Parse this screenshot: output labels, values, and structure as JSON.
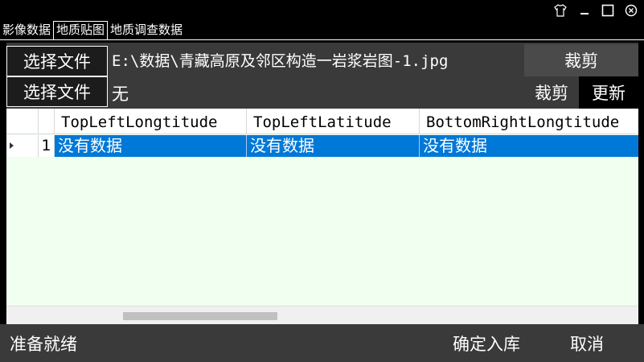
{
  "window": {
    "controls": [
      {
        "name": "theme",
        "icon": "shirt-icon"
      },
      {
        "name": "minimize",
        "icon": "minimize-icon"
      },
      {
        "name": "maximize",
        "icon": "maximize-icon"
      },
      {
        "name": "close",
        "icon": "close-circle-icon"
      }
    ]
  },
  "tabs": [
    {
      "label": "影像数据",
      "active": false
    },
    {
      "label": "地质贴图",
      "active": true
    },
    {
      "label": "地质调查数据",
      "active": false
    }
  ],
  "toolbar": {
    "select_file_1": "选择文件",
    "file_path_1": "E:\\数据\\青藏高原及邻区构造一岩浆岩图-1.jpg",
    "select_file_2": "选择文件",
    "file_path_2": "无",
    "crop_header": "裁剪",
    "crop_button": "裁剪",
    "update_button": "更新"
  },
  "table": {
    "columns": [
      "TopLeftLongtitude",
      "TopLeftLatitude",
      "BottomRightLongtitude"
    ],
    "rows": [
      {
        "index": "1",
        "cells": [
          "没有数据",
          "没有数据",
          "没有数据"
        ],
        "selected": true
      }
    ]
  },
  "status": {
    "text": "准备就绪",
    "confirm_button": "确定入库",
    "cancel_button": "取消"
  },
  "colors": {
    "background": "#000000",
    "panel": "#3a3a3a",
    "grid_background": "#f0fff0",
    "selection": "#0078d7"
  }
}
